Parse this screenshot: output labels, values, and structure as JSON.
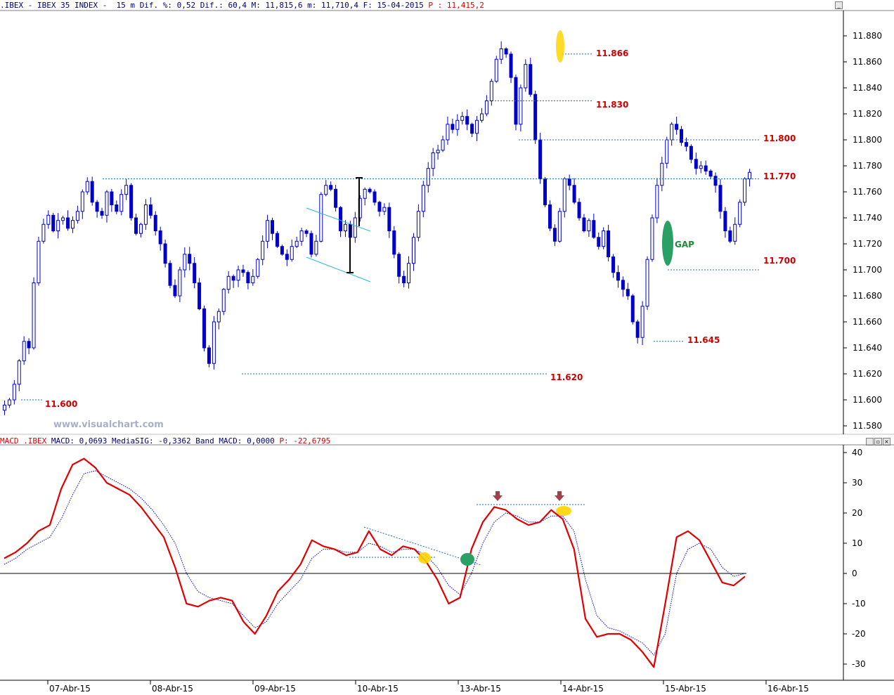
{
  "header": {
    "symbol": ".IBEX - IBEX 35 INDEX -  15 m",
    "dif_pct_label": "Dif. %:",
    "dif_pct": "0,52",
    "dif_label": "Dif.:",
    "dif": "60,4",
    "max_label": "M:",
    "max": "11,815,6",
    "min_label": "m:",
    "min": "11,710,4",
    "date_label": "F:",
    "date": "15-04-2015",
    "price_label": "P :",
    "price": "11,415,2"
  },
  "macd_header": {
    "name": "MACD_.IBEX",
    "macd_label": "MACD:",
    "macd": "0,0693",
    "sig_label": "MediaSIG:",
    "sig": "-0,3362",
    "band_label": "Band_MACD:",
    "band": "0,0000",
    "p_label": "P:",
    "p": "-22,6795"
  },
  "watermark": "www.visualchart.com",
  "colors": {
    "candle": "#0000cc",
    "macd": "#e00000",
    "signal": "#0000cc",
    "level_text": "#cc0000",
    "level_line": "#1f6fb0",
    "channel": "#2ab8d8",
    "yellow_marker": "#ffd400",
    "green_marker": "#2aa064",
    "arrow": "#a0404a"
  },
  "chart_data": [
    {
      "type": "candlestick",
      "title": "",
      "x_dates": [
        "07-Abr-15",
        "08-Abr-15",
        "09-Abr-15",
        "10-Abr-15",
        "13-Abr-15",
        "14-Abr-15",
        "15-Abr-15",
        "16-Abr-15"
      ],
      "y_ticks": [
        "11.580",
        "11.600",
        "11.620",
        "11.640",
        "11.660",
        "11.680",
        "11.700",
        "11.720",
        "11.740",
        "11.760",
        "11.780",
        "11.800",
        "11.820",
        "11.840",
        "11.860",
        "11.880"
      ],
      "ylim": [
        11575,
        11900
      ],
      "key_levels": [
        {
          "value": "11.600"
        },
        {
          "value": "11.620"
        },
        {
          "value": "11.645"
        },
        {
          "value": "11.700"
        },
        {
          "value": "11.770"
        },
        {
          "value": "11.800"
        },
        {
          "value": "11.830"
        },
        {
          "value": "11.866"
        }
      ],
      "annotations": [
        "GAP"
      ],
      "approx_closes": [
        11596,
        11600,
        11612,
        11630,
        11645,
        11640,
        11690,
        11722,
        11735,
        11742,
        11730,
        11738,
        11740,
        11732,
        11738,
        11745,
        11760,
        11768,
        11752,
        11745,
        11742,
        11760,
        11750,
        11745,
        11758,
        11765,
        11740,
        11728,
        11735,
        11750,
        11742,
        11730,
        11720,
        11705,
        11688,
        11680,
        11700,
        11712,
        11705,
        11690,
        11670,
        11640,
        11628,
        11660,
        11668,
        11685,
        11695,
        11692,
        11700,
        11698,
        11690,
        11695,
        11708,
        11722,
        11738,
        11728,
        11718,
        11712,
        11708,
        11718,
        11722,
        11730,
        11728,
        11712,
        11722,
        11758,
        11765,
        11762,
        11748,
        11730,
        11735,
        11725,
        11740,
        11755,
        11762,
        11760,
        11752,
        11745,
        11748,
        11730,
        11712,
        11695,
        11690,
        11705,
        11725,
        11745,
        11765,
        11778,
        11790,
        11792,
        11800,
        11812,
        11808,
        11815,
        11818,
        11812,
        11805,
        11815,
        11820,
        11830,
        11845,
        11862,
        11870,
        11866,
        11848,
        11812,
        11840,
        11858,
        11835,
        11800,
        11770,
        11750,
        11732,
        11722,
        11745,
        11770,
        11765,
        11752,
        11740,
        11730,
        11738,
        11725,
        11718,
        11730,
        11710,
        11698,
        11692,
        11685,
        11680,
        11660,
        11648,
        11672,
        11708,
        11740,
        11765,
        11782,
        11800,
        11812,
        11808,
        11798,
        11795,
        11785,
        11778,
        11780,
        11776,
        11772,
        11765,
        11745,
        11730,
        11722,
        11735,
        11752,
        11770,
        11775
      ]
    },
    {
      "type": "line",
      "title": "",
      "x_dates": [
        "07-Abr-15",
        "08-Abr-15",
        "09-Abr-15",
        "10-Abr-15",
        "13-Abr-15",
        "14-Abr-15",
        "15-Abr-15",
        "16-Abr-15"
      ],
      "y_ticks": [
        "40",
        "30",
        "20",
        "10",
        "0",
        "-10",
        "-20",
        "-30"
      ],
      "ylim": [
        -35,
        41
      ],
      "series": [
        {
          "name": "MACD",
          "values": [
            5,
            7,
            10,
            14,
            16,
            28,
            36,
            38,
            35,
            30,
            28,
            26,
            22,
            17,
            12,
            2,
            -10,
            -11,
            -9,
            -8,
            -9,
            -16,
            -20,
            -14,
            -6,
            -2,
            3,
            11,
            9,
            8,
            6,
            7,
            14,
            8,
            6,
            9,
            8,
            4,
            -2,
            -10,
            -8,
            8,
            17,
            22,
            21,
            18,
            16,
            17,
            21,
            18,
            8,
            -15,
            -21,
            -20,
            -20,
            -22,
            -26,
            -31,
            -10,
            12,
            14,
            11,
            4,
            -3,
            -4,
            -1
          ]
        },
        {
          "name": "MediaSIG",
          "values": [
            3,
            5,
            8,
            10,
            12,
            18,
            26,
            33,
            34,
            32,
            30,
            28,
            25,
            21,
            16,
            10,
            0,
            -6,
            -8,
            -9,
            -10,
            -14,
            -18,
            -16,
            -10,
            -6,
            -2,
            5,
            8,
            8,
            7,
            7,
            10,
            9,
            7,
            8,
            8,
            6,
            2,
            -4,
            -7,
            0,
            10,
            17,
            20,
            19,
            17,
            17,
            19,
            19,
            14,
            -2,
            -14,
            -18,
            -19,
            -21,
            -23,
            -27,
            -20,
            0,
            8,
            10,
            8,
            2,
            -1,
            0
          ]
        }
      ]
    }
  ]
}
